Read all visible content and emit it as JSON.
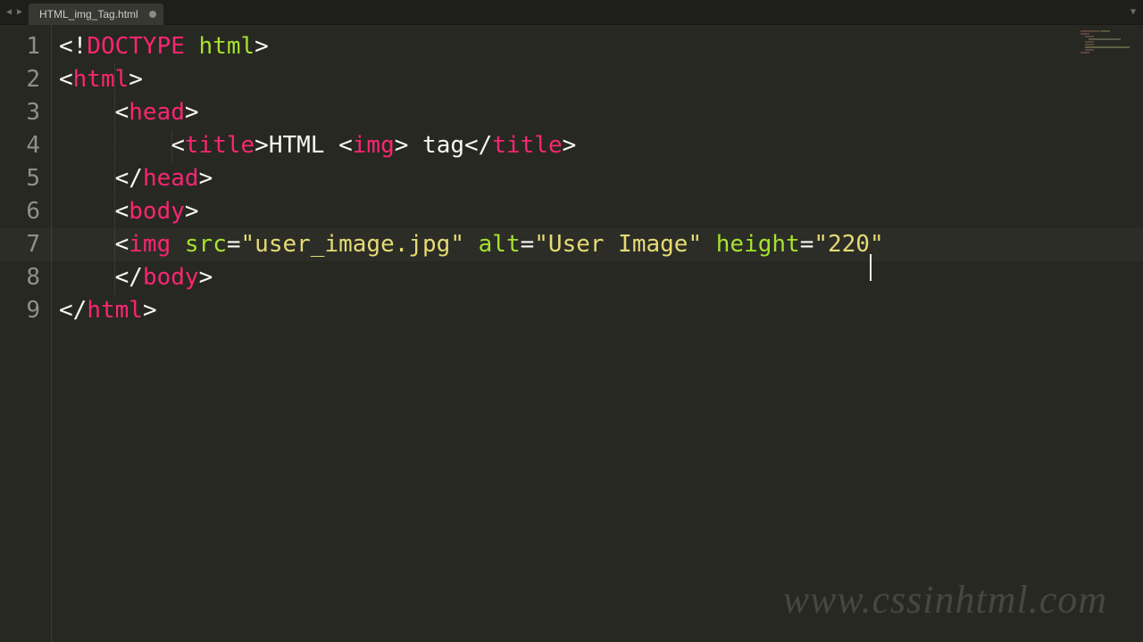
{
  "tab": {
    "filename": "HTML_img_Tag.html",
    "dirty": true
  },
  "lines": [
    "1",
    "2",
    "3",
    "4",
    "5",
    "6",
    "7",
    "8",
    "9"
  ],
  "active_line": 7,
  "code": {
    "l1": {
      "p1": "<!",
      "doctype": "DOCTYPE",
      "sp": " ",
      "attr": "html",
      "p2": ">"
    },
    "l2": {
      "p1": "<",
      "tag": "html",
      "p2": ">"
    },
    "l3": {
      "indent": "    ",
      "p1": "<",
      "tag": "head",
      "p2": ">"
    },
    "l4": {
      "indent": "        ",
      "p1": "<",
      "tag1": "title",
      "p2": ">",
      "txt1": "HTML ",
      "p3": "<",
      "tag2": "img",
      "p4": ">",
      "txt2": " tag",
      "p5": "</",
      "tag3": "title",
      "p6": ">"
    },
    "l5": {
      "indent": "    ",
      "p1": "</",
      "tag": "head",
      "p2": ">"
    },
    "l6": {
      "indent": "    ",
      "p1": "<",
      "tag": "body",
      "p2": ">"
    },
    "l7": {
      "indent": "    ",
      "p1": "<",
      "tag": "img",
      "sp1": " ",
      "attr1": "src",
      "eq1": "=",
      "str1": "\"user_image.jpg\"",
      "sp2": " ",
      "attr2": "alt",
      "eq2": "=",
      "str2": "\"User Image\"",
      "sp3": " ",
      "attr3": "height",
      "eq3": "=",
      "str3a": "\"220",
      "str3b": "\""
    },
    "l8": {
      "indent": "    ",
      "p1": "</",
      "tag": "body",
      "p2": ">"
    },
    "l9": {
      "p1": "</",
      "tag": "html",
      "p2": ">"
    }
  },
  "watermark": "www.cssinhtml.com"
}
